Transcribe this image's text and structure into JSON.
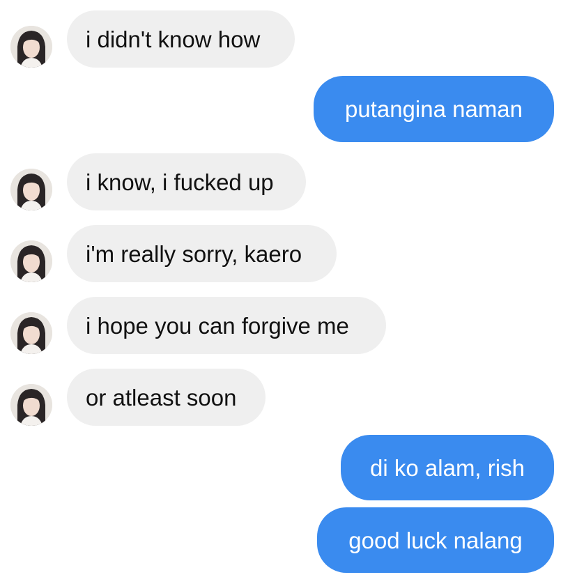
{
  "messages": [
    {
      "side": "incoming",
      "text": "i didn't know how",
      "avatar_icon": "contact-avatar-icon"
    },
    {
      "side": "outgoing",
      "text": "putangina naman"
    },
    {
      "side": "incoming",
      "text": "i know, i fucked up",
      "avatar_icon": "contact-avatar-icon"
    },
    {
      "side": "incoming",
      "text": "i'm really sorry, kaero",
      "avatar_icon": "contact-avatar-icon"
    },
    {
      "side": "incoming",
      "text": "i hope you can forgive me",
      "avatar_icon": "contact-avatar-icon"
    },
    {
      "side": "incoming",
      "text": "or atleast soon",
      "avatar_icon": "contact-avatar-icon"
    },
    {
      "side": "outgoing",
      "text": "di ko alam, rish"
    },
    {
      "side": "outgoing",
      "text": "good luck nalang"
    }
  ],
  "colors": {
    "incoming_bubble": "#efefef",
    "incoming_text": "#111111",
    "outgoing_bubble": "#3a8bef",
    "outgoing_text": "#ffffff",
    "background": "#ffffff"
  }
}
